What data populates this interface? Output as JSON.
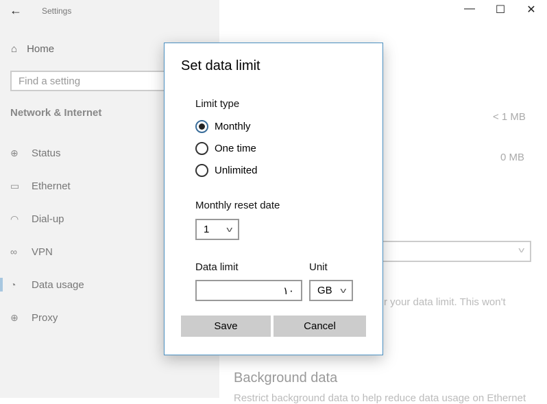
{
  "window": {
    "title": "Settings",
    "back_icon": "arrow-left-icon",
    "minimize": "—",
    "maximize": "☐",
    "close": "✕"
  },
  "sidebar": {
    "home": "Home",
    "search_placeholder": "Find a setting",
    "section": "Network & Internet",
    "items": [
      {
        "label": "Status",
        "icon": "globe-icon",
        "glyph": "⊕"
      },
      {
        "label": "Ethernet",
        "icon": "ethernet-icon",
        "glyph": "▭"
      },
      {
        "label": "Dial-up",
        "icon": "dialup-icon",
        "glyph": "◠"
      },
      {
        "label": "VPN",
        "icon": "vpn-icon",
        "glyph": "∞"
      },
      {
        "label": "Data usage",
        "icon": "data-usage-icon",
        "glyph": "◔"
      },
      {
        "label": "Proxy",
        "icon": "globe-icon",
        "glyph": "⊕"
      }
    ],
    "active": "Data usage"
  },
  "main": {
    "usage1": "< 1 MB",
    "usage2": "0 MB",
    "partial_text": "r your data limit. This won't",
    "background_title": "Background data",
    "background_desc": "Restrict background data to help reduce data usage on Ethernet"
  },
  "dialog": {
    "title": "Set data limit",
    "limit_type_label": "Limit type",
    "options": [
      "Monthly",
      "One time",
      "Unlimited"
    ],
    "selected": "Monthly",
    "reset_label": "Monthly reset date",
    "reset_value": "1",
    "data_limit_label": "Data limit",
    "data_limit_value": "١٠",
    "unit_label": "Unit",
    "unit_value": "GB",
    "save": "Save",
    "cancel": "Cancel"
  },
  "colors": {
    "accent": "#4a8fc0",
    "sidebar_bg": "#f2f2f2",
    "button_bg": "#cccccc"
  }
}
